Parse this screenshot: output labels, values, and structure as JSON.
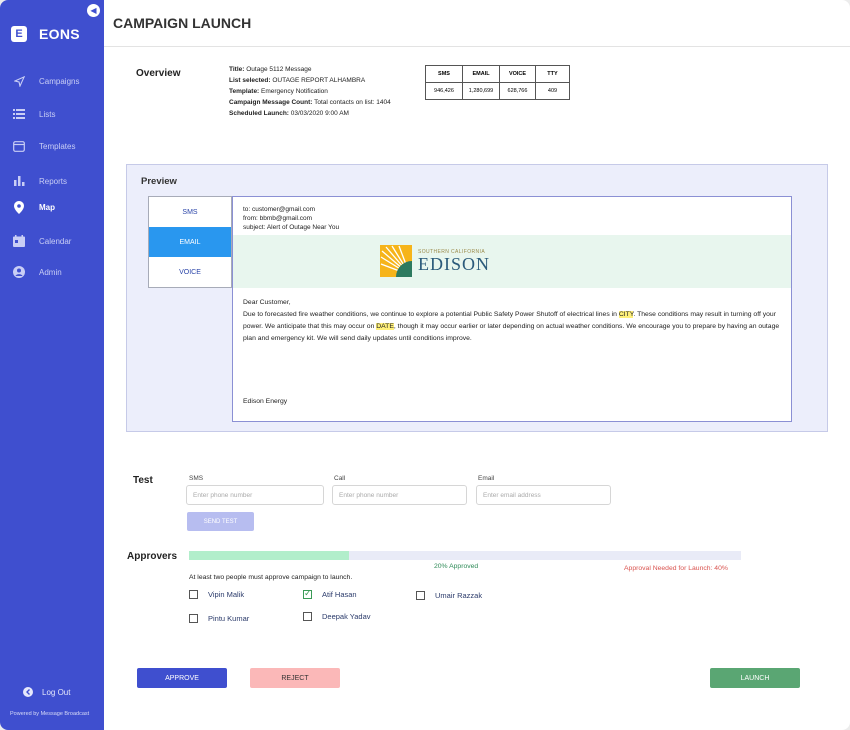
{
  "sidebar": {
    "brand_letter": "E",
    "brand_name": "EONS",
    "items": [
      {
        "label": "Campaigns",
        "icon": "send-icon"
      },
      {
        "label": "Lists",
        "icon": "list-icon"
      },
      {
        "label": "Templates",
        "icon": "template-icon"
      },
      {
        "label": "Reports",
        "icon": "bar-chart-icon"
      },
      {
        "label": "Map",
        "icon": "map-pin-icon",
        "active": true
      },
      {
        "label": "Calendar",
        "icon": "calendar-icon"
      },
      {
        "label": "Admin",
        "icon": "user-icon"
      }
    ],
    "logout": "Log Out",
    "powered_by": "Powered by Message Broadcast"
  },
  "header": {
    "title": "CAMPAIGN LAUNCH"
  },
  "overview": {
    "label": "Overview",
    "title_label": "Title:",
    "title_value": "Outage 5112 Message",
    "list_label": "List selected:",
    "list_value": "OUTAGE REPORT ALHAMBRA",
    "template_label": "Template:",
    "template_value": "Emergency Notification",
    "count_label": "Campaign Message Count:",
    "count_value": "Total contacts on list: 1404",
    "scheduled_label": "Scheduled Launch:",
    "scheduled_value": "03/03/2020 9:00 AM",
    "stats_headers": [
      "SMS",
      "EMAIL",
      "VOICE",
      "TTY"
    ],
    "stats_values": [
      "946,426",
      "1,280,699",
      "628,766",
      "409"
    ]
  },
  "preview": {
    "label": "Preview",
    "tabs": [
      "SMS",
      "EMAIL",
      "VOICE"
    ],
    "active_tab": "EMAIL",
    "to": "to: customer@gmail.com",
    "from": "from: bbmb@gmail.com",
    "subject": "subject: Alert of Outage Near You",
    "logo_small": "SOUTHERN CALIFORNIA",
    "logo_big": "EDISON",
    "greeting": "Dear Customer,",
    "body_part1": "Due to forecasted fire weather conditions, we continue to explore a potential Public Safety Power Shutoff of electrical lines in ",
    "body_var1": "CITY",
    "body_part2": ". These conditions may result in turning off your power. We anticipate that this may occur on ",
    "body_var2": "DATE",
    "body_part3": ", though it may occur earlier or later depending on actual weather conditions. We encourage you to prepare by having an outage plan and emergency kit. We will send daily updates until conditions improve.",
    "signature": "Edison Energy"
  },
  "test": {
    "label": "Test",
    "sms_label": "SMS",
    "sms_placeholder": "Enter phone number",
    "call_label": "Call",
    "call_placeholder": "Enter phone number",
    "email_label": "Email",
    "email_placeholder": "Enter email address",
    "send_button": "SEND TEST"
  },
  "approvers": {
    "label": "Approvers",
    "progress_fraction": 0.29,
    "approved_text": "20% Approved",
    "needed_text": "Approval Needed for Launch: 40%",
    "note": "At least two people must approve campaign to launch.",
    "people": [
      {
        "name": "Vipin Malik",
        "checked": false
      },
      {
        "name": "Atif Hasan",
        "checked": true
      },
      {
        "name": "Umair Razzak",
        "checked": false
      },
      {
        "name": "Pintu Kumar",
        "checked": false
      },
      {
        "name": "Deepak Yadav",
        "checked": false
      }
    ]
  },
  "actions": {
    "approve": "APPROVE",
    "reject": "REJECT",
    "launch": "LAUNCH"
  },
  "colors": {
    "sidebar": "#3f4fcf",
    "approve": "#3f4fcf",
    "reject": "#fbb8b8",
    "launch": "#5aa673",
    "active_tab": "#2997ef",
    "needed_text": "#d9534f",
    "approved_text": "#2e8b57"
  }
}
